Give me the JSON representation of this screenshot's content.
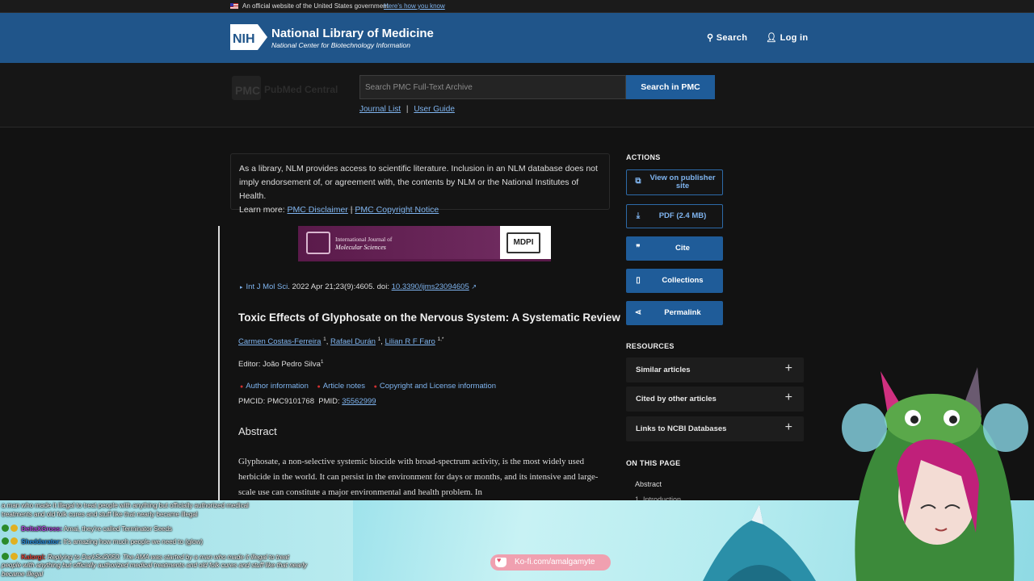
{
  "gov_banner": {
    "text": "An official website of the United States government",
    "how_link": "Here's how you know"
  },
  "nih_header": {
    "logo": "NIH",
    "title": "National Library of Medicine",
    "subtitle": "National Center for Biotechnology Information",
    "search_label": "Search",
    "login_label": "Log in"
  },
  "pmc_bar": {
    "logo_label": "PMC",
    "logo_label2": "PubMed Central",
    "search_placeholder": "Search PMC Full-Text Archive",
    "search_button": "Search in PMC",
    "links": [
      "Journal List",
      "User Guide"
    ],
    "separator": "|"
  },
  "disclaimer": {
    "text": "As a library, NLM provides access to scientific literature. Inclusion in an NLM database does not imply endorsement of, or agreement with, the contents by NLM or the National Institutes of Health.",
    "learn_more": "Learn more:",
    "link1": "PMC Disclaimer",
    "sep": "|",
    "link2": "PMC Copyright Notice"
  },
  "journal_banner": {
    "line1": "International Journal of",
    "line2": "Molecular Sciences",
    "publisher": "MDPI"
  },
  "article": {
    "journal_link": "Int J Mol Sci",
    "citation": ". 2022 Apr 21;23(9):4605. doi: ",
    "doi": "10.3390/ijms23094605",
    "title": "Toxic Effects of Glyphosate on the Nervous System: A Systematic Review",
    "authors": [
      {
        "name": "Carmen Costas-Ferreira",
        "sup": "1"
      },
      {
        "name": "Rafael Durán",
        "sup": "1"
      },
      {
        "name": "Lilian R F Faro",
        "sup": "1,*"
      }
    ],
    "editor_label": "Editor: João Pedro Silva",
    "editor_sup": "1",
    "info_links": [
      "Author information",
      "Article notes",
      "Copyright and License information"
    ],
    "pmcid": "PMCID: PMC9101768  PMID: ",
    "pmid": "35562999",
    "abstract_heading": "Abstract",
    "abstract_text": "Glyphosate, a non-selective systemic biocide with broad-spectrum activity, is the most widely used herbicide in the world. It can persist in the environment for days or months, and its intensive and large-scale use can constitute a major environmental and health problem. In"
  },
  "sidebar": {
    "actions_heading": "ACTIONS",
    "actions": [
      {
        "label": "View on publisher site",
        "icon": "external-link-icon"
      },
      {
        "label": "PDF (2.4 MB)",
        "icon": "download-icon"
      },
      {
        "label": "Cite",
        "icon": "quote-icon"
      },
      {
        "label": "Collections",
        "icon": "bookmark-icon"
      },
      {
        "label": "Permalink",
        "icon": "share-icon"
      }
    ],
    "resources_heading": "RESOURCES",
    "resources": [
      "Similar articles",
      "Cited by other articles",
      "Links to NCBI Databases"
    ],
    "on_this_page_heading": "ON THIS PAGE",
    "on_this_page": [
      "Abstract",
      "1. Introduction"
    ]
  },
  "overlay": {
    "chat": [
      {
        "text": "a man who made it illegal to treat people with anything but officially authorized medical"
      },
      {
        "text": "treatments and old folk cures and stuff like that nearly became illegal"
      },
      {
        "name": "DeltaXGross:",
        "msg": " Amai, they're called Terminator Seeds"
      },
      {
        "name": "Sheddarator:",
        "msg": " It's amazing how much people we need to (glow)"
      },
      {
        "name": "Kalorgi:",
        "msg": " Replying to DarkSol2050: The AMA was started by a man who made it illegal to treat"
      },
      {
        "text": "people with anything but officially authorized medical treatments and old folk cures and stuff like that nearly"
      },
      {
        "text": "became illegal"
      }
    ],
    "kofi": "Ko-fi.com/amalgamyte"
  },
  "colors": {
    "nih_blue": "#20558a",
    "button_blue": "#1f5c99",
    "link_blue": "#7fb4ef",
    "page_bg": "#121212"
  }
}
